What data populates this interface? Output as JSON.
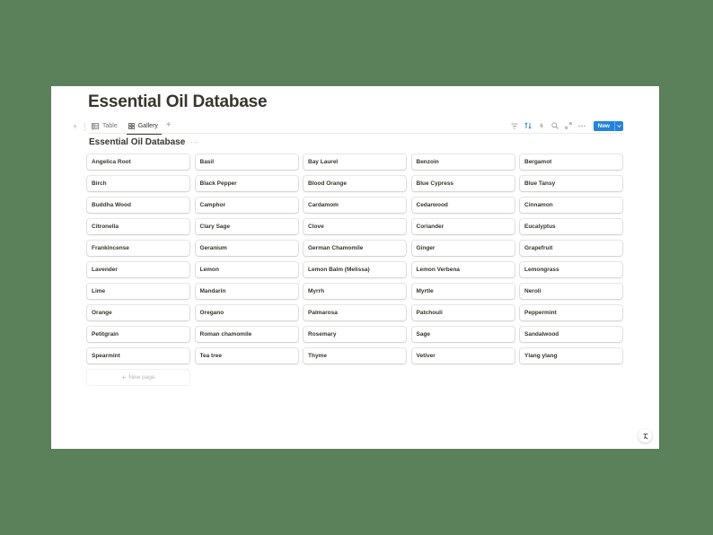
{
  "page": {
    "title": "Essential Oil Database"
  },
  "views": {
    "tabs": [
      {
        "label": "Table",
        "icon": "table-icon",
        "active": false
      },
      {
        "label": "Gallery",
        "icon": "gallery-icon",
        "active": true
      }
    ],
    "add_view_icon": "plus-icon"
  },
  "toolbar": {
    "icons": [
      "filter-icon",
      "sort-icon",
      "automation-icon",
      "search-icon",
      "expand-icon",
      "more-icon"
    ],
    "new_label": "New",
    "new_dropdown_icon": "chevron-down-icon",
    "accent_color": "#2383e2"
  },
  "database": {
    "title": "Essential Oil Database",
    "more_icon": "more-icon",
    "cards": [
      "Angelica Root",
      "Basil",
      "Bay Laurel",
      "Benzoin",
      "Bergamot",
      "Birch",
      "Black Pepper",
      "Blood Orange",
      "Blue Cypress",
      "Blue Tansy",
      "Buddha Wood",
      "Camphor",
      "Cardamom",
      "Cedarwood",
      "Cinnamon",
      "Citronella",
      "Clary Sage",
      "Clove",
      "Coriander",
      "Eucalyptus",
      "Frankincense",
      "Geranium",
      "German Chamomile",
      "Ginger",
      "Grapefruit",
      "Lavender",
      "Lemon",
      "Lemon Balm (Melissa)",
      "Lemon Verbena",
      "Lemongrass",
      "Lime",
      "Mandarin",
      "Myrrh",
      "Myrtle",
      "Neroli",
      "Orange",
      "Oregano",
      "Palmarosa",
      "Patchouli",
      "Peppermint",
      "Petitgrain",
      "Roman chamomile",
      "Rosemary",
      "Sage",
      "Sandalwood",
      "Spearmint",
      "Tea tree",
      "Thyme",
      "Vetiver",
      "Ylang ylang"
    ],
    "new_page_label": "New page"
  },
  "colors": {
    "background": "#5a8159",
    "page": "#ffffff",
    "text": "#37352f"
  }
}
